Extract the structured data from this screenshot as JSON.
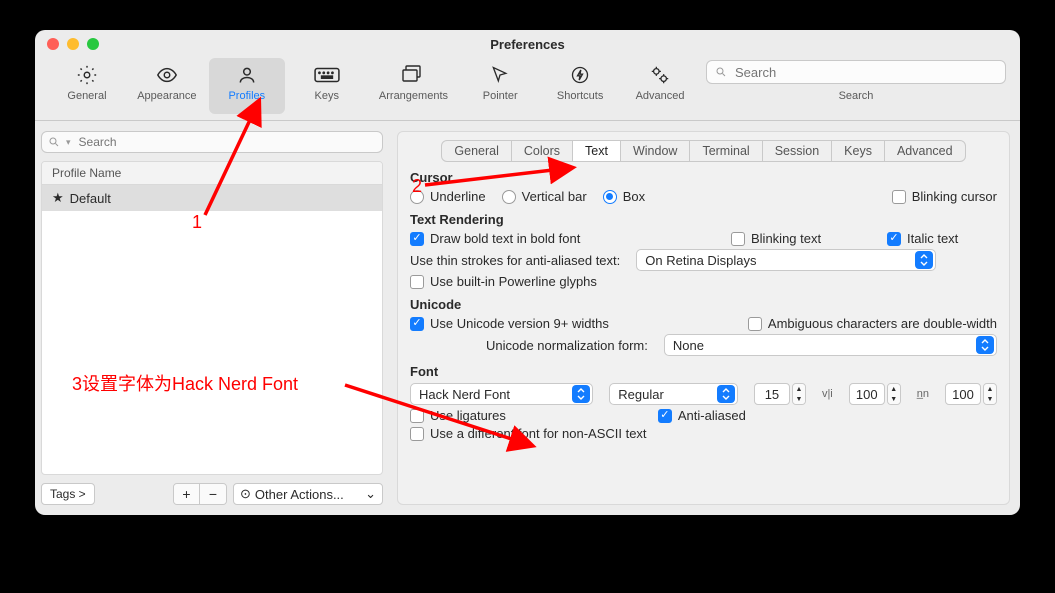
{
  "window_title": "Preferences",
  "toolbar": {
    "items": [
      {
        "id": "general",
        "label": "General"
      },
      {
        "id": "appearance",
        "label": "Appearance"
      },
      {
        "id": "profiles",
        "label": "Profiles"
      },
      {
        "id": "keys",
        "label": "Keys"
      },
      {
        "id": "arrangements",
        "label": "Arrangements"
      },
      {
        "id": "pointer",
        "label": "Pointer"
      },
      {
        "id": "shortcuts",
        "label": "Shortcuts"
      },
      {
        "id": "advanced",
        "label": "Advanced"
      }
    ],
    "search_placeholder": "Search",
    "search_label": "Search"
  },
  "left": {
    "search_placeholder": "Search",
    "header": "Profile Name",
    "rows": [
      {
        "star": "★",
        "name": "Default"
      }
    ],
    "tags": "Tags >",
    "plus": "+",
    "minus": "−",
    "other_icon": "⊙",
    "other_actions": "Other Actions...",
    "chev": "⌄"
  },
  "tabs": [
    "General",
    "Colors",
    "Text",
    "Window",
    "Terminal",
    "Session",
    "Keys",
    "Advanced"
  ],
  "cursor": {
    "title": "Cursor",
    "opts": [
      "Underline",
      "Vertical bar",
      "Box"
    ],
    "blink": "Blinking cursor"
  },
  "render": {
    "title": "Text Rendering",
    "bold": "Draw bold text in bold font",
    "blink": "Blinking text",
    "italic": "Italic text",
    "thin_label": "Use thin strokes for anti-aliased text:",
    "thin_value": "On Retina Displays",
    "powerline": "Use built-in Powerline glyphs"
  },
  "unicode": {
    "title": "Unicode",
    "v9": "Use Unicode version 9+ widths",
    "ambig": "Ambiguous characters are double-width",
    "norm_label": "Unicode normalization form:",
    "norm_value": "None"
  },
  "font": {
    "title": "Font",
    "family": "Hack Nerd Font",
    "style": "Regular",
    "size": "15",
    "vli_label": "v|i",
    "vli": "100",
    "nn_label": "n̲n",
    "nn": "100",
    "ligatures": "Use ligatures",
    "anti": "Anti-aliased",
    "nonascii": "Use a different font for non-ASCII text"
  },
  "annotations": {
    "a1": "1",
    "a2": "2",
    "a3": "3设置字体为Hack Nerd Font"
  }
}
